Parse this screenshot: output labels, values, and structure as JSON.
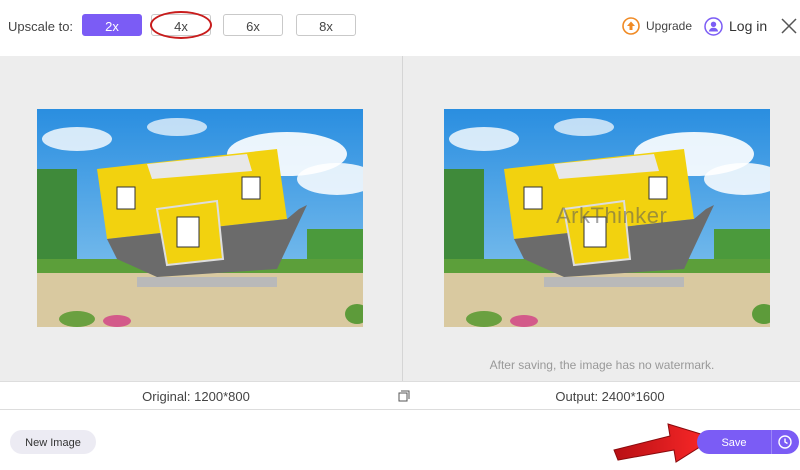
{
  "toolbar": {
    "upscale_label": "Upscale to:",
    "scales": [
      {
        "label": "2x",
        "active": true
      },
      {
        "label": "4x",
        "active": false
      },
      {
        "label": "6x",
        "active": false
      },
      {
        "label": "8x",
        "active": false
      }
    ],
    "upgrade_label": "Upgrade",
    "login_label": "Log in"
  },
  "preview": {
    "watermark_text": "ArkThinker",
    "no_watermark_note": "After saving, the image has no watermark."
  },
  "info": {
    "original_label": "Original: 1200*800",
    "output_label": "Output: 2400*1600"
  },
  "footer": {
    "new_image_label": "New Image",
    "save_label": "Save"
  },
  "colors": {
    "accent": "#7b5cf5",
    "upgrade_icon": "#f08a24",
    "annotation_red": "#d8161b"
  }
}
